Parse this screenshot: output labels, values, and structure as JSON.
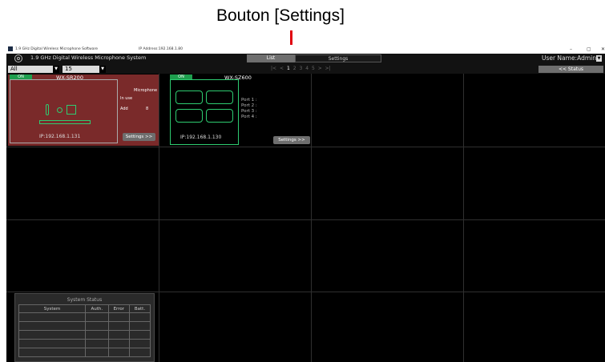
{
  "annotation": {
    "label": "Bouton [Settings]"
  },
  "window": {
    "title": "1.9 GHz Digital Wireless Microphone Software",
    "ip_address": "IP Address:192.168.1.80",
    "controls": {
      "minimize": "–",
      "maximize": "▢",
      "close": "✕"
    }
  },
  "header": {
    "system_name": "1.9 GHz Digital Wireless Microphone System",
    "tabs": [
      {
        "label": "List"
      },
      {
        "label": "Settings"
      }
    ],
    "user_name": "User Name:Admin"
  },
  "filters": {
    "group": "All",
    "count": "15",
    "pagination": {
      "first": "|<",
      "prev": "<",
      "pages": [
        "1",
        "2",
        "3",
        "4",
        "5"
      ],
      "current": "1",
      "next": ">",
      "last": ">|"
    },
    "status_button": "<< Status"
  },
  "devices": [
    {
      "status": "ON",
      "model": "WX-SR200",
      "microphone_label": "Microphone",
      "in_use_label": "In use",
      "add_label": "Add",
      "add_value": "8",
      "ip": "IP:192.168.1.131",
      "settings_button": "Settings >>",
      "status_color": "#1e9e4e",
      "card_color": "#7a2a2a"
    },
    {
      "status": "ON",
      "model": "WX-SZ600",
      "ports": [
        "Port 1 :",
        "Port 2 :",
        "Port 3 :",
        "Port 4 :"
      ],
      "ip": "IP:192.168.1.130",
      "settings_button": "Settings >>"
    }
  ],
  "system_status": {
    "title": "System Status",
    "columns": [
      "System",
      "Auth.",
      "Error",
      "Batt."
    ]
  },
  "colors": {
    "accent_highlight": "#e0000f",
    "on_green": "#1e9e4e",
    "outline_green": "#2ecc71"
  }
}
